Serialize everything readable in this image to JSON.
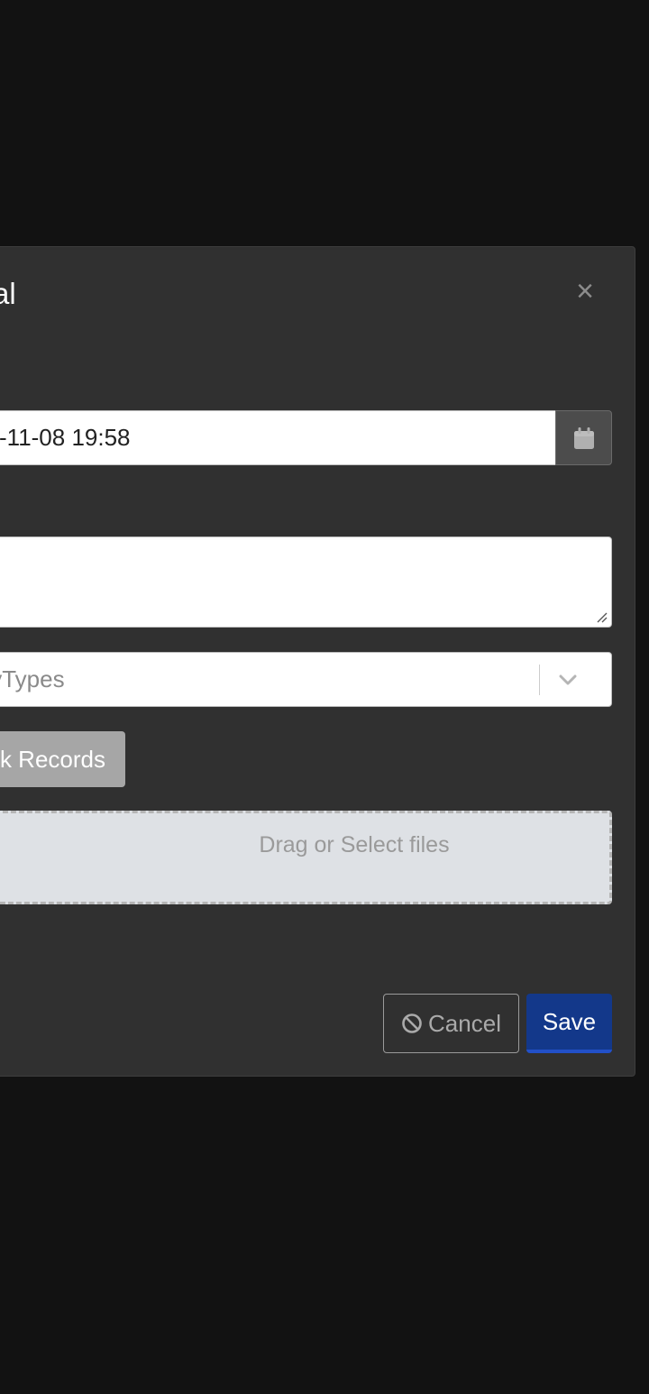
{
  "modal": {
    "title": "ral",
    "close_label": "×"
  },
  "date_field": {
    "value": "-11-08 19:58"
  },
  "notes_field": {
    "value": ""
  },
  "type_select": {
    "value": "tyTypes"
  },
  "link_records_button": {
    "label": "k Records"
  },
  "dropzone": {
    "label": "Drag or Select files"
  },
  "footer": {
    "cancel_label": "Cancel",
    "save_label": "Save"
  },
  "colors": {
    "backdrop": "#121212",
    "modal_bg": "#303030",
    "save_bg": "#13388a",
    "link_button_bg": "#a6a6a6",
    "dropzone_bg": "#dee1e5"
  },
  "icons": {
    "close": "close-icon",
    "calendar": "calendar-icon",
    "chevron": "chevron-down-icon",
    "cancel": "ban-icon"
  }
}
